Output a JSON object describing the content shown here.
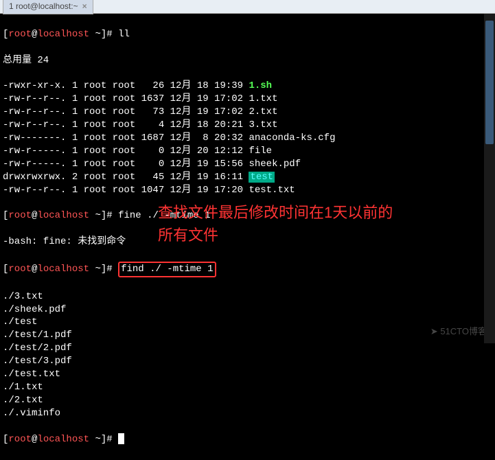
{
  "titlebar": {
    "tab_label": "1 root@localhost:~"
  },
  "prompt": {
    "user": "root",
    "host": "localhost",
    "path": "~",
    "symbol": "#"
  },
  "cmd1": "ll",
  "total_label": "总用量 24",
  "listing": [
    {
      "perm": "-rwxr-xr-x.",
      "links": "1",
      "owner": "root",
      "group": "root",
      "size": "  26",
      "month": "12月",
      "day": "18",
      "time": "19:39",
      "name": "1.sh",
      "class": "green-bold"
    },
    {
      "perm": "-rw-r--r--.",
      "links": "1",
      "owner": "root",
      "group": "root",
      "size": "1637",
      "month": "12月",
      "day": "19",
      "time": "17:02",
      "name": "1.txt",
      "class": "white"
    },
    {
      "perm": "-rw-r--r--.",
      "links": "1",
      "owner": "root",
      "group": "root",
      "size": "  73",
      "month": "12月",
      "day": "19",
      "time": "17:02",
      "name": "2.txt",
      "class": "white"
    },
    {
      "perm": "-rw-r--r--.",
      "links": "1",
      "owner": "root",
      "group": "root",
      "size": "   4",
      "month": "12月",
      "day": "18",
      "time": "20:21",
      "name": "3.txt",
      "class": "white"
    },
    {
      "perm": "-rw-------.",
      "links": "1",
      "owner": "root",
      "group": "root",
      "size": "1687",
      "month": "12月",
      "day": " 8",
      "time": "20:32",
      "name": "anaconda-ks.cfg",
      "class": "white"
    },
    {
      "perm": "-rw-r-----.",
      "links": "1",
      "owner": "root",
      "group": "root",
      "size": "   0",
      "month": "12月",
      "day": "20",
      "time": "12:12",
      "name": "file",
      "class": "white"
    },
    {
      "perm": "-rw-r-----.",
      "links": "1",
      "owner": "root",
      "group": "root",
      "size": "   0",
      "month": "12月",
      "day": "19",
      "time": "15:56",
      "name": "sheek.pdf",
      "class": "white"
    },
    {
      "perm": "drwxrwxrwx.",
      "links": "2",
      "owner": "root",
      "group": "root",
      "size": "  45",
      "month": "12月",
      "day": "19",
      "time": "16:11",
      "name": "test",
      "class": "cyan-bg"
    },
    {
      "perm": "-rw-r--r--.",
      "links": "1",
      "owner": "root",
      "group": "root",
      "size": "1047",
      "month": "12月",
      "day": "19",
      "time": "17:20",
      "name": "test.txt",
      "class": "white"
    }
  ],
  "cmd2": "fine ./ -mtime 1",
  "error_line": "-bash: fine: 未找到命令",
  "cmd3": "find ./ -mtime 1",
  "results": [
    "./3.txt",
    "./sheek.pdf",
    "./test",
    "./test/1.pdf",
    "./test/2.pdf",
    "./test/3.pdf",
    "./test.txt",
    "./1.txt",
    "./2.txt",
    "./.viminfo"
  ],
  "annotation_line1": "查找文件最后修改时间在1天以前的",
  "annotation_line2": "所有文件",
  "watermark": "➤ 51CTO博客"
}
